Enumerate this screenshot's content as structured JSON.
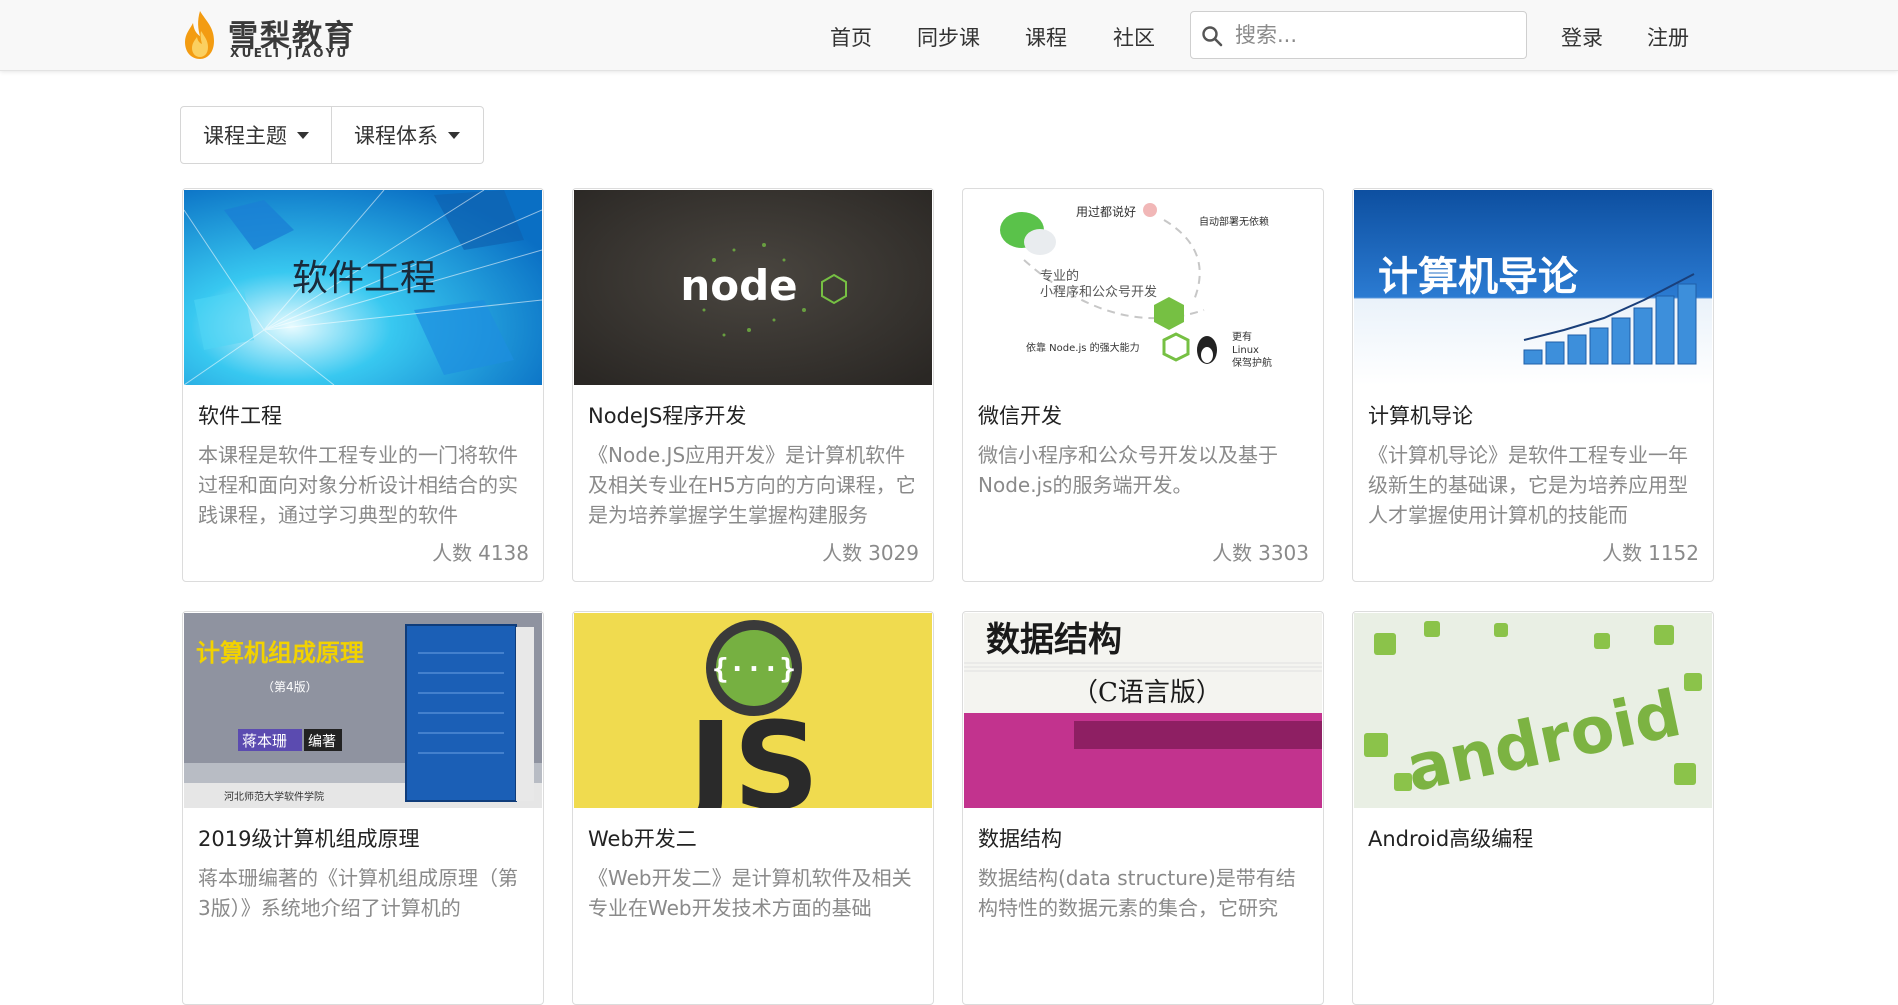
{
  "header": {
    "logo_cn": "雪梨教育",
    "logo_en": "XUELI JIAOYU",
    "nav": [
      "首页",
      "同步课",
      "课程",
      "社区"
    ],
    "search_placeholder": "搜索...",
    "login": "登录",
    "register": "注册"
  },
  "filters": {
    "topic": "课程主题",
    "system": "课程体系"
  },
  "courses": [
    {
      "title": "软件工程",
      "image_text": "软件工程",
      "desc": "本课程是软件工程专业的一门将软件过程和面向对象分析设计相结合的实践课程，通过学习典型的软件",
      "count_label": "人数",
      "count": "4138"
    },
    {
      "title": "NodeJS程序开发",
      "image_text": "node",
      "desc": "《Node.JS应用开发》是计算机软件及相关专业在H5方向的方向课程，它是为培养掌握学生掌握构建服务",
      "count_label": "人数",
      "count": "3029"
    },
    {
      "title": "微信开发",
      "image_text": "专业的小程序和公众号开发",
      "image_labels": [
        "用过都说好",
        "专业的",
        "小程序和公众号开发",
        "依靠 Node.js 的强大能力",
        "自动部署无依赖",
        "更有",
        "Linux",
        "保驾护航"
      ],
      "desc": "微信小程序和公众号开发以及基于Node.js的服务端开发。",
      "count_label": "人数",
      "count": "3303"
    },
    {
      "title": "计算机导论",
      "image_text": "计算机导论",
      "desc": "《计算机导论》是软件工程专业一年级新生的基础课，它是为培养应用型人才掌握使用计算机的技能而",
      "count_label": "人数",
      "count": "1152"
    },
    {
      "title": "2019级计算机组成原理",
      "image_text": "计算机组成原理",
      "image_labels": [
        "（第4版）",
        "蒋本珊",
        "编著",
        "河北师范大学软件学院"
      ],
      "desc": "蒋本珊编著的《计算机组成原理（第3版）》系统地介绍了计算机的",
      "count_label": "",
      "count": ""
    },
    {
      "title": "Web开发二",
      "image_text": "JS",
      "desc": "《Web开发二》是计算机软件及相关专业在Web开发技术方面的基础",
      "count_label": "",
      "count": ""
    },
    {
      "title": "数据结构",
      "image_text": "数据结构",
      "image_labels": [
        "（C语言版）"
      ],
      "desc": "数据结构(data structure)是带有结构特性的数据元素的集合，它研究",
      "count_label": "",
      "count": ""
    },
    {
      "title": "Android高级编程",
      "image_text": "android",
      "desc": "",
      "count_label": "",
      "count": ""
    }
  ],
  "colors": {
    "navbar_bg": "#f8f8f8",
    "logo_flame": "#f39c12",
    "text_muted": "#8a8a8a",
    "node_green": "#7cb342",
    "js_yellow": "#f0db4f",
    "android_green": "#8bc34a"
  }
}
